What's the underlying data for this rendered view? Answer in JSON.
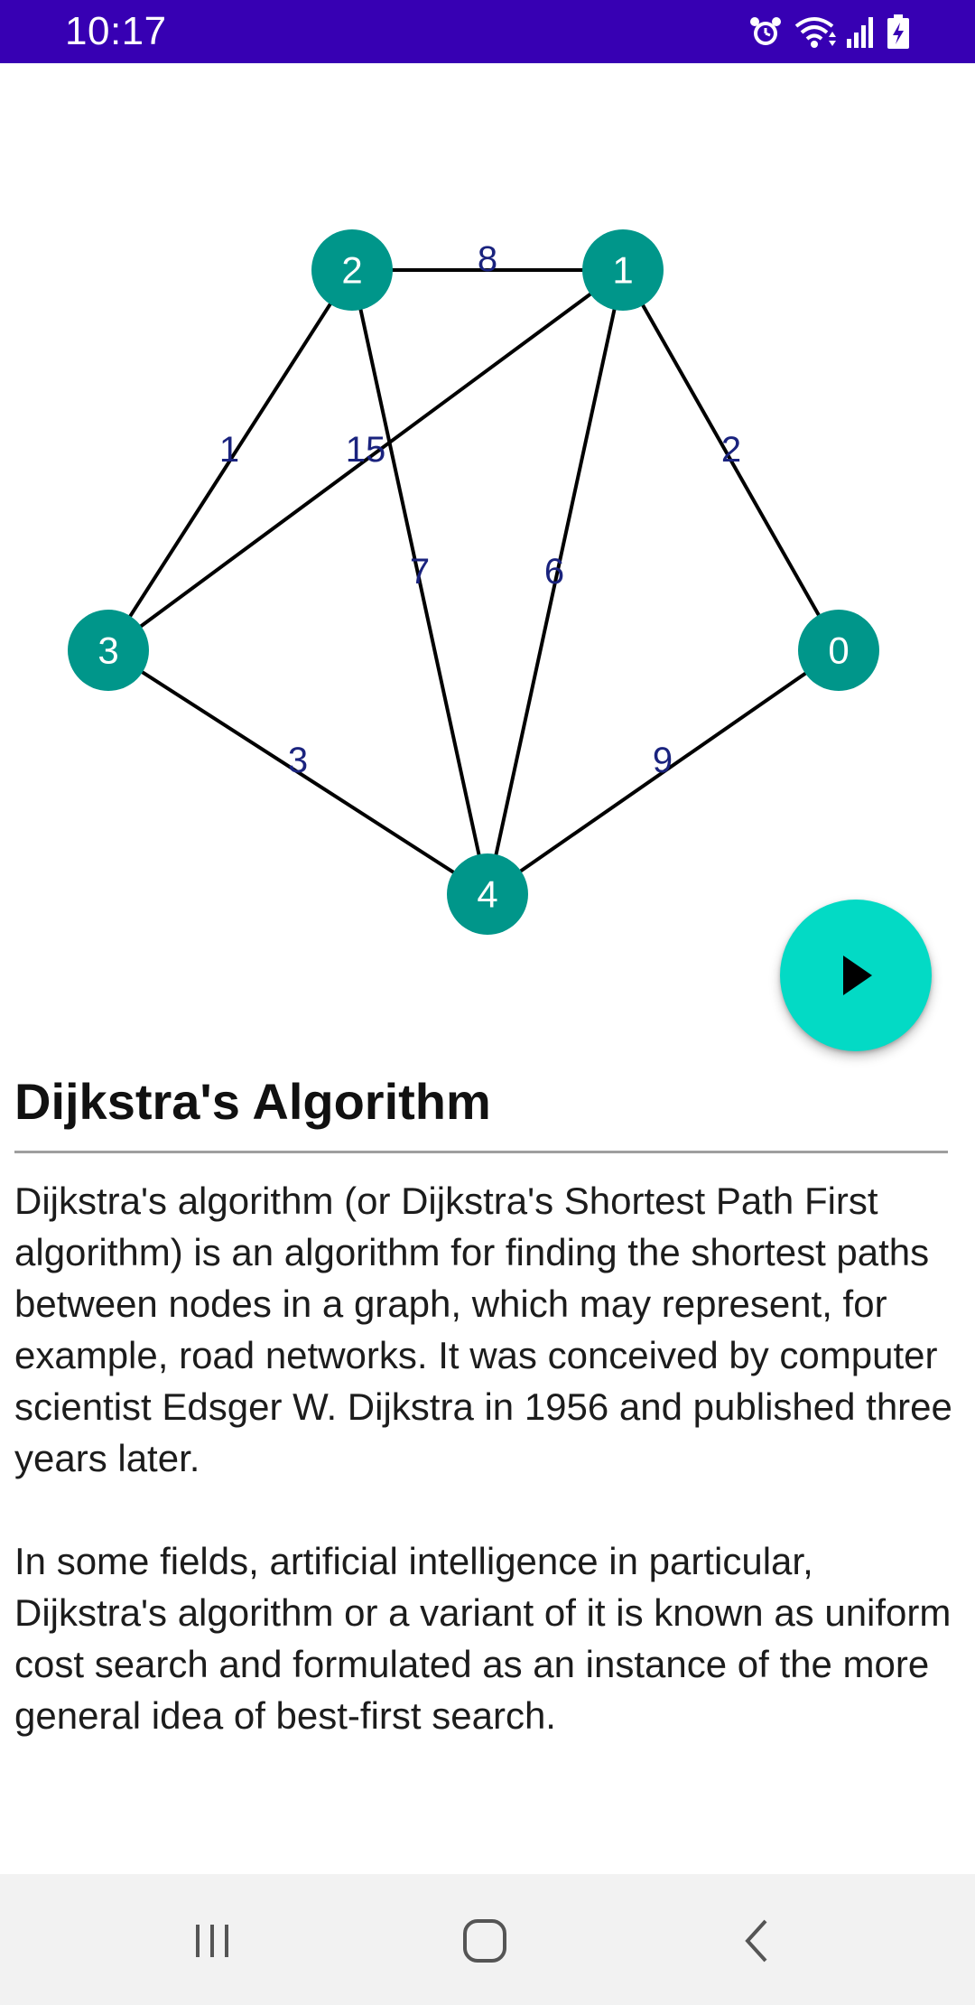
{
  "status_bar": {
    "time": "10:17",
    "icons": [
      "alarm-icon",
      "wifi-icon",
      "signal-icon",
      "battery-charging-icon"
    ],
    "background": "#3700b3"
  },
  "graph": {
    "nodes": [
      {
        "id": "0",
        "label": "0"
      },
      {
        "id": "1",
        "label": "1"
      },
      {
        "id": "2",
        "label": "2"
      },
      {
        "id": "3",
        "label": "3"
      },
      {
        "id": "4",
        "label": "4"
      }
    ],
    "edges": [
      {
        "from": "2",
        "to": "1",
        "weight": "8"
      },
      {
        "from": "2",
        "to": "3",
        "weight": "1"
      },
      {
        "from": "1",
        "to": "3",
        "weight": "15"
      },
      {
        "from": "1",
        "to": "0",
        "weight": "2"
      },
      {
        "from": "2",
        "to": "4",
        "weight": "7"
      },
      {
        "from": "1",
        "to": "4",
        "weight": "6"
      },
      {
        "from": "3",
        "to": "4",
        "weight": "3"
      },
      {
        "from": "0",
        "to": "4",
        "weight": "9"
      }
    ],
    "node_color": "#00968a",
    "edge_label_color": "#1a237e"
  },
  "play_button": {
    "icon": "play-icon",
    "color": "#03dac5"
  },
  "article": {
    "title": "Dijkstra's Algorithm",
    "paragraphs": [
      "Dijkstra's algorithm (or Dijkstra's Shortest Path First algorithm) is an algorithm for finding the shortest paths between nodes in a graph, which may represent, for example, road networks. It was conceived by computer scientist Edsger W. Dijkstra in 1956 and published three years later.",
      "In some fields, artificial intelligence in particular, Dijkstra's algorithm or a variant of it is known as uniform cost search and formulated as an instance of the more general idea of best-first search."
    ]
  },
  "nav_bar": {
    "buttons": [
      "recents-icon",
      "home-icon",
      "back-icon"
    ]
  }
}
